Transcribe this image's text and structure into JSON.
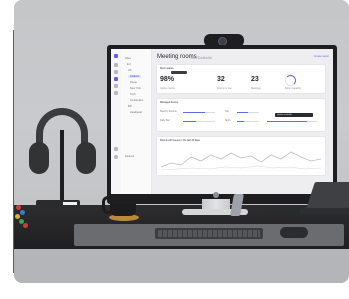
{
  "screen": {
    "title": "Meeting rooms",
    "subtitle": "UK/Dalkeith",
    "link": "Create report",
    "tree": [
      "Sites",
      "EU",
      "UK",
      "Dalkeith",
      "Rome",
      "New York",
      "Tech",
      "Amsterdam",
      "BR",
      "Headquart"
    ],
    "tree_footer": "Devices",
    "summary": {
      "heading": "Room status",
      "stats": [
        {
          "value": "98%",
          "label": "Uptime rooms"
        },
        {
          "value": "32",
          "label": "Rooms in use"
        },
        {
          "value": "23",
          "label": "Meetings"
        }
      ],
      "ring_label": "Room capacity"
    },
    "managed": {
      "heading": "Managed Rooms",
      "rows": [
        "MeetUp Rooms",
        "Tap",
        "Rally Bar",
        "Sight"
      ],
      "tooltip_label": "Update available"
    },
    "chart_heading": "Rooms with issues in the last 30 days"
  }
}
